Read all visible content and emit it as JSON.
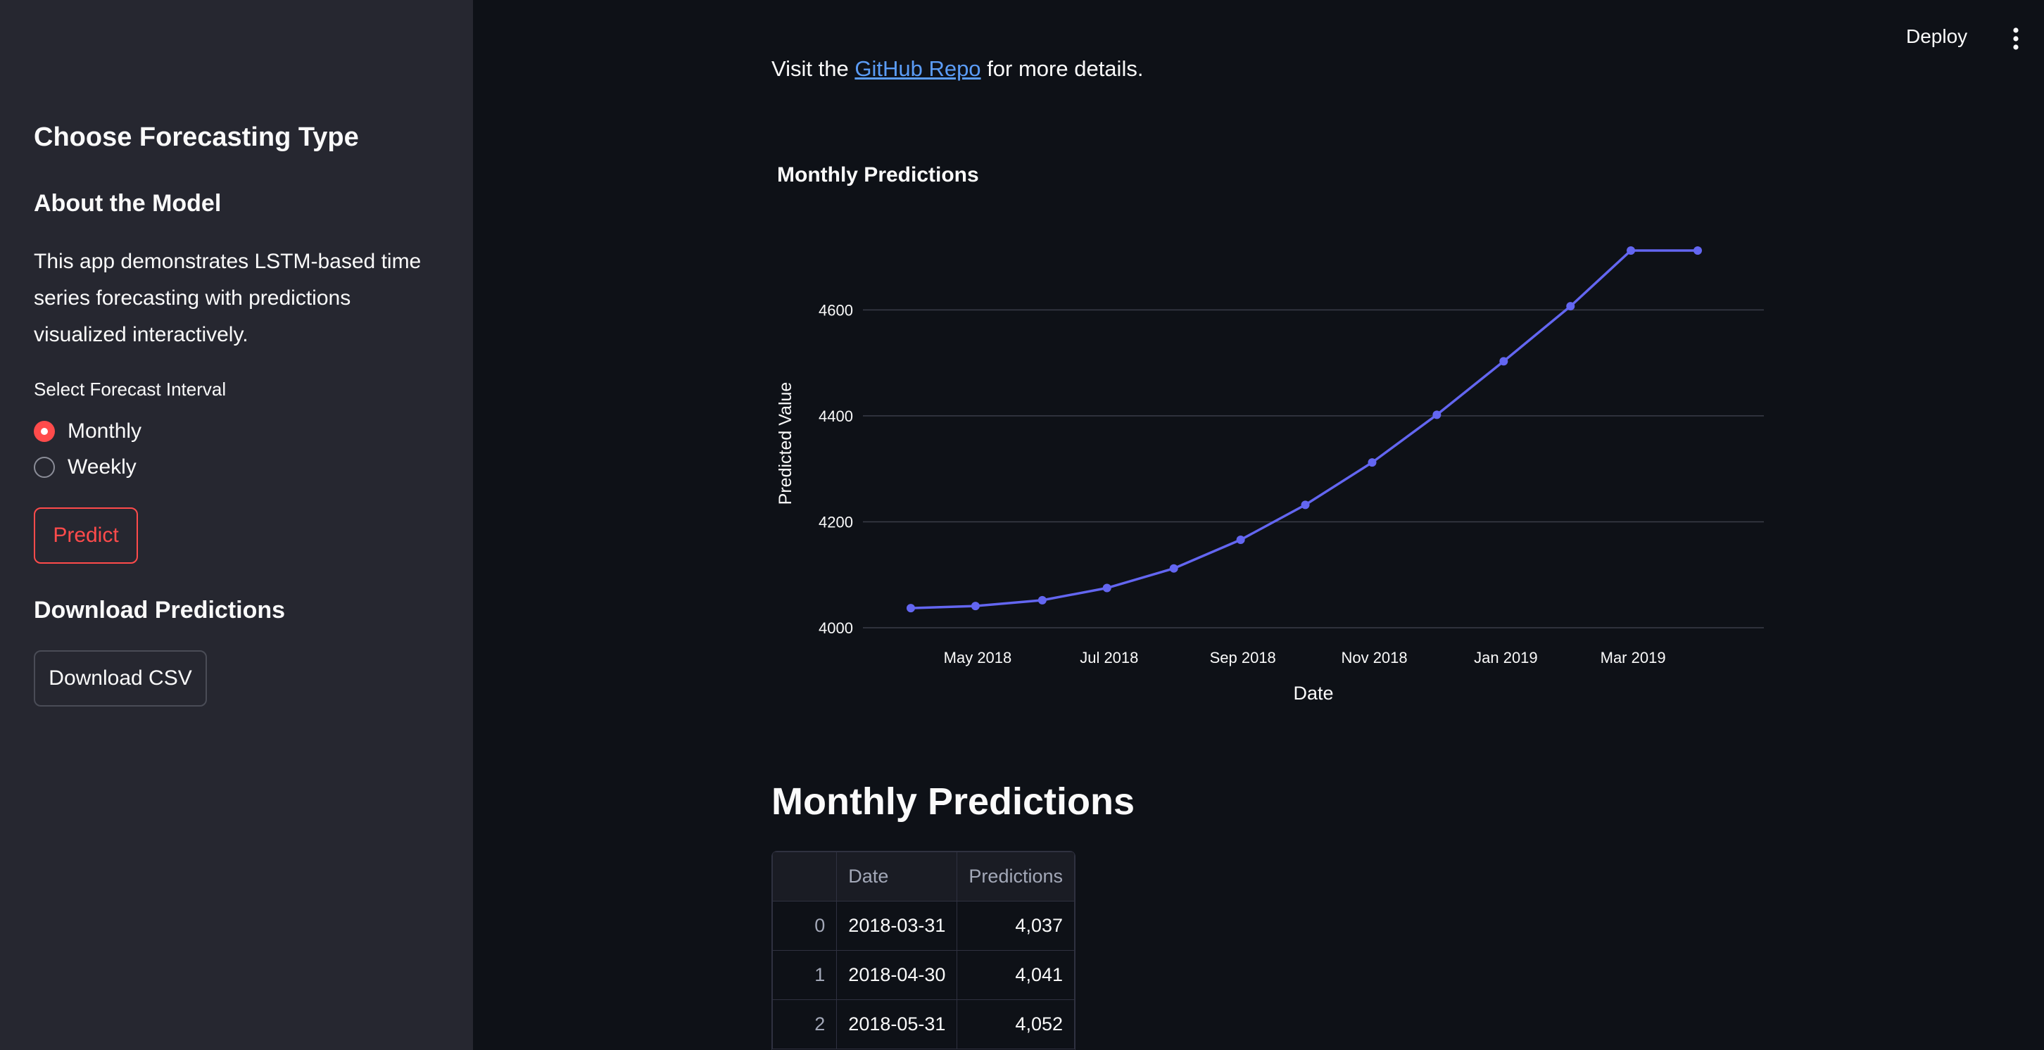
{
  "header": {
    "deploy_label": "Deploy",
    "menu_icon": "vertical-ellipsis-icon"
  },
  "sidebar": {
    "title": "Choose Forecasting Type",
    "about_heading": "About the Model",
    "about_text": "This app demonstrates LSTM-based time series forecasting with predictions visualized interactively.",
    "interval_label": "Select Forecast Interval",
    "options": [
      {
        "label": "Monthly",
        "selected": true
      },
      {
        "label": "Weekly",
        "selected": false
      }
    ],
    "predict_label": "Predict",
    "download_heading": "Download Predictions",
    "download_label": "Download CSV"
  },
  "main": {
    "intro_prefix": "Visit the",
    "intro_link": "GitHub Repo",
    "intro_suffix": "for more details.",
    "table_heading": "Monthly Predictions",
    "table": {
      "columns": [
        "",
        "Date",
        "Predictions"
      ],
      "rows": [
        {
          "index": "0",
          "date": "2018-03-31",
          "value": "4,037"
        },
        {
          "index": "1",
          "date": "2018-04-30",
          "value": "4,041"
        },
        {
          "index": "2",
          "date": "2018-05-31",
          "value": "4,052"
        }
      ]
    }
  },
  "colors": {
    "accent": "#ff4b4b",
    "line": "#6366f1",
    "link": "#5b9cf6",
    "sidebar_bg": "#262730",
    "main_bg": "#0e1117"
  },
  "chart_data": {
    "type": "line",
    "title": "Monthly Predictions",
    "xlabel": "Date",
    "ylabel": "Predicted Value",
    "x": [
      "2018-03-31",
      "2018-04-30",
      "2018-05-31",
      "2018-06-30",
      "2018-07-31",
      "2018-08-31",
      "2018-09-30",
      "2018-10-31",
      "2018-11-30",
      "2018-12-31",
      "2019-01-31",
      "2019-02-28",
      "2019-03-31"
    ],
    "values": [
      4037,
      4041,
      4052,
      4075,
      4112,
      4166,
      4232,
      4312,
      4402,
      4503,
      4607,
      4712,
      4712
    ],
    "x_tick_labels": [
      "May 2018",
      "Jul 2018",
      "Sep 2018",
      "Nov 2018",
      "Jan 2019",
      "Mar 2019"
    ],
    "x_tick_dates": [
      "2018-05-01",
      "2018-07-01",
      "2018-09-01",
      "2018-11-01",
      "2019-01-01",
      "2019-03-01"
    ],
    "y_ticks": [
      4000,
      4200,
      4400,
      4600
    ],
    "ylim": [
      4000,
      4720
    ],
    "grid": true
  }
}
